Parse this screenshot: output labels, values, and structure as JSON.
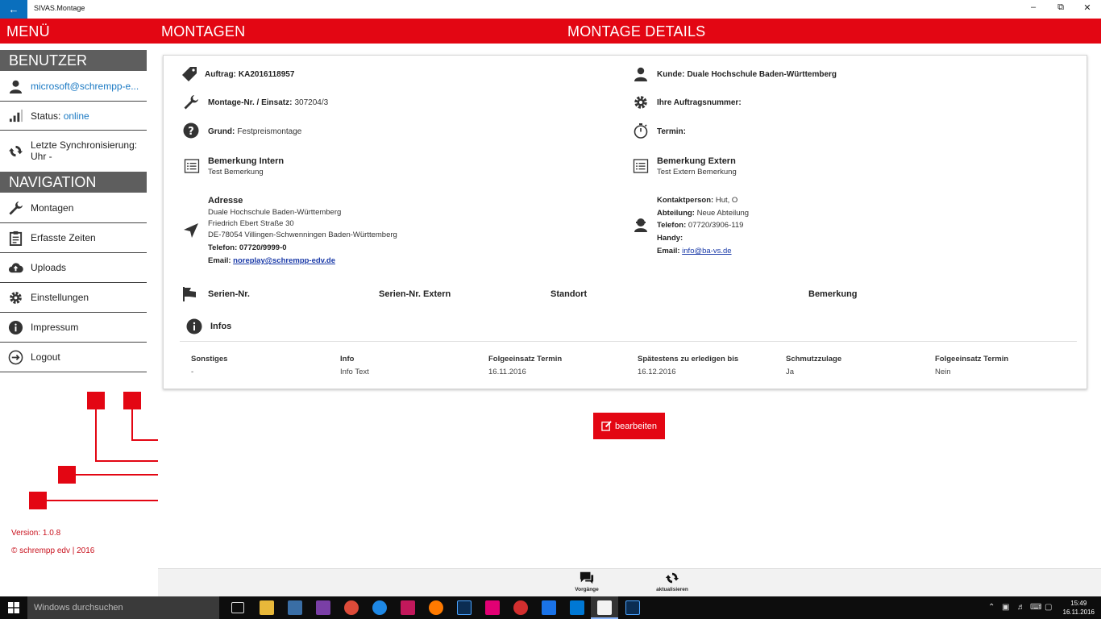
{
  "window": {
    "title": "SIVAS.Montage"
  },
  "header": {
    "menu": "MENÜ",
    "section": "MONTAGEN",
    "page_title": "MONTAGE DETAILS"
  },
  "sidebar": {
    "user_heading": "BENUTZER",
    "user_email": "microsoft@schrempp-e...",
    "status_label": "Status:",
    "status_value": "online",
    "sync_label": "Letzte Synchronisierung:",
    "sync_value": "Uhr -",
    "nav_heading": "NAVIGATION",
    "nav_items": [
      {
        "label": "Montagen",
        "icon": "wrench-icon"
      },
      {
        "label": "Erfasste Zeiten",
        "icon": "clipboard-icon"
      },
      {
        "label": "Uploads",
        "icon": "cloud-upload-icon"
      },
      {
        "label": "Einstellungen",
        "icon": "gear-icon"
      },
      {
        "label": "Impressum",
        "icon": "info-icon"
      },
      {
        "label": "Logout",
        "icon": "logout-icon"
      }
    ],
    "version": "Version: 1.0.8",
    "copyright": "© schrempp edv | 2016"
  },
  "details": {
    "auftrag_label": "Auftrag:",
    "auftrag_value": "KA2016118957",
    "montage_label": "Montage-Nr. / Einsatz:",
    "montage_value": "307204/3",
    "grund_label": "Grund:",
    "grund_value": "Festpreismontage",
    "kunde_label": "Kunde:",
    "kunde_value": "Duale Hochschule Baden-Württemberg",
    "auftragsnummer_label": "Ihre Auftragsnummer:",
    "auftragsnummer_value": "",
    "termin_label": "Termin:",
    "termin_value": "",
    "bemerkung_intern_title": "Bemerkung Intern",
    "bemerkung_intern_text": "Test Bemerkung",
    "bemerkung_extern_title": "Bemerkung Extern",
    "bemerkung_extern_text": "Test Extern Bemerkung",
    "adresse": {
      "title": "Adresse",
      "line1": "Duale Hochschule Baden-Württemberg",
      "line2": "Friedrich Ebert Straße 30",
      "line3": "DE-78054 Villingen-Schwenningen Baden-Württemberg",
      "telefon": "Telefon: 07720/9999-0",
      "email_label": "Email:",
      "email": "noreplay@schrempp-edv.de"
    },
    "kontakt": {
      "person_label": "Kontaktperson:",
      "person_value": "Hut, O",
      "abteilung_label": "Abteilung:",
      "abteilung_value": "Neue Abteilung",
      "telefon_label": "Telefon:",
      "telefon_value": "07720/3906-119",
      "handy_label": "Handy:",
      "handy_value": "",
      "email_label": "Email:",
      "email_value": "info@ba-vs.de"
    },
    "serial_columns": [
      "Serien-Nr.",
      "Serien-Nr. Extern",
      "Standort",
      "Bemerkung"
    ],
    "infos_title": "Infos",
    "info_table": {
      "headers": [
        "Sonstiges",
        "Info",
        "Folgeeinsatz Termin",
        "Spätestens zu erledigen bis",
        "Schmutzzulage",
        "Folgeeinsatz Termin"
      ],
      "values": [
        "-",
        "Info Text",
        "16.11.2016",
        "16.12.2016",
        "Ja",
        "Nein"
      ]
    }
  },
  "edit_button": "bearbeiten",
  "appbar": {
    "vorgaenge": "Vorgänge",
    "aktualisieren": "aktualisieren"
  },
  "taskbar": {
    "search_placeholder": "Windows durchsuchen",
    "time": "15:49",
    "date": "16.11.2016"
  },
  "colors": {
    "brand_red": "#e30613",
    "link_blue": "#1a79c3",
    "sidebar_heading": "#5e5e5e"
  }
}
